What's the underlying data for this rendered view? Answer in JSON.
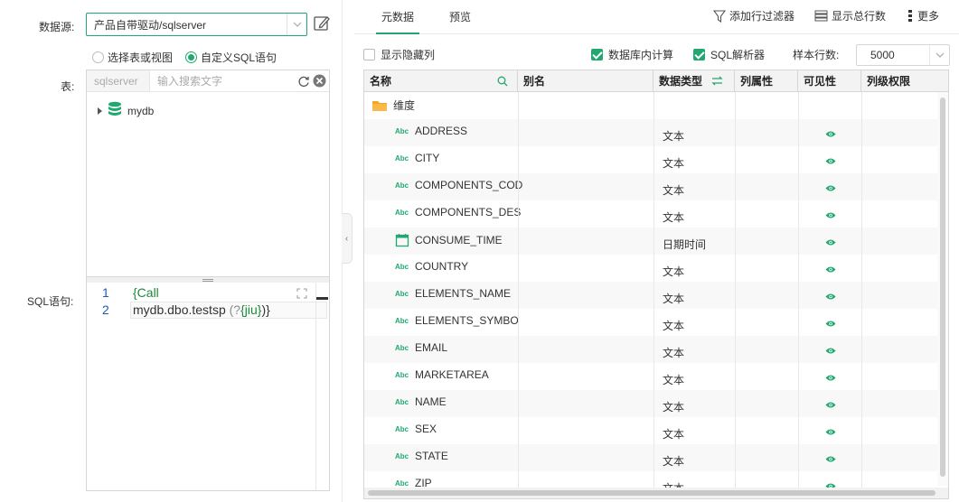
{
  "left": {
    "datasource_label": "数据源:",
    "datasource_value": "产品自带驱动/sqlserver",
    "radio_table": "选择表或视图",
    "radio_sql": "自定义SQL语句",
    "table_label": "表:",
    "schema": "sqlserver",
    "search_placeholder": "输入搜索文字",
    "tree_node": "mydb",
    "sql_label": "SQL语句:",
    "sql_lines": [
      {
        "num": "1",
        "text": "{Call"
      },
      {
        "num": "2",
        "text_main": "mydb.dbo.testsp ",
        "text_param_open": "(?",
        "text_param": "{jiu}",
        "text_param_close": ")}"
      }
    ]
  },
  "right": {
    "tabs": [
      "元数据",
      "预览"
    ],
    "toolbar": {
      "add_filter": "添加行过滤器",
      "show_total": "显示总行数",
      "more": "更多"
    },
    "options": {
      "show_hidden": "显示隐藏列",
      "db_compute": "数据库内计算",
      "sql_parser": "SQL解析器",
      "sample_rows_label": "样本行数:",
      "sample_rows_value": "5000"
    },
    "grid": {
      "headers": [
        "名称",
        "别名",
        "数据类型",
        "列属性",
        "可见性",
        "列级权限"
      ],
      "group": "维度",
      "rows": [
        {
          "name": "ADDRESS",
          "type": "文本",
          "icon": "text-icon"
        },
        {
          "name": "CITY",
          "type": "文本",
          "icon": "text-icon"
        },
        {
          "name": "COMPONENTS_COD",
          "type": "文本",
          "icon": "text-icon"
        },
        {
          "name": "COMPONENTS_DES",
          "type": "文本",
          "icon": "text-icon"
        },
        {
          "name": "CONSUME_TIME",
          "type": "日期时间",
          "icon": "calendar-icon"
        },
        {
          "name": "COUNTRY",
          "type": "文本",
          "icon": "text-icon"
        },
        {
          "name": "ELEMENTS_NAME",
          "type": "文本",
          "icon": "text-icon"
        },
        {
          "name": "ELEMENTS_SYMBO",
          "type": "文本",
          "icon": "text-icon"
        },
        {
          "name": "EMAIL",
          "type": "文本",
          "icon": "text-icon"
        },
        {
          "name": "MARKETAREA",
          "type": "文本",
          "icon": "text-icon"
        },
        {
          "name": "NAME",
          "type": "文本",
          "icon": "text-icon"
        },
        {
          "name": "SEX",
          "type": "文本",
          "icon": "text-icon"
        },
        {
          "name": "STATE",
          "type": "文本",
          "icon": "text-icon"
        },
        {
          "name": "ZIP",
          "type": "文本",
          "icon": "text-icon"
        }
      ]
    }
  },
  "colors": {
    "accent": "#21a870",
    "folder": "#f5a623",
    "line_number": "#1a5db5"
  }
}
